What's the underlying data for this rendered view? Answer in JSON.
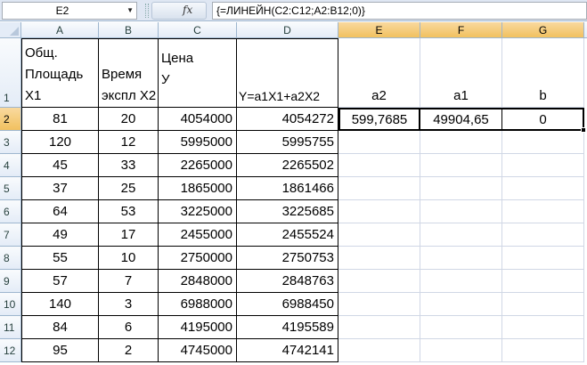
{
  "formula_bar": {
    "name_box": "E2",
    "fx_label": "fx",
    "formula": "{=ЛИНЕЙН(C2:C12;A2:B12;0)}"
  },
  "columns": [
    "A",
    "B",
    "C",
    "D",
    "E",
    "F",
    "G"
  ],
  "row_numbers": [
    "1",
    "2",
    "3",
    "4",
    "5",
    "6",
    "7",
    "8",
    "9",
    "10",
    "11",
    "12"
  ],
  "headers": {
    "A": "Общ. Площадь Х1",
    "B": "Время экспл Х2",
    "C": "Цена У",
    "D": "Y=a1X1+a2X2",
    "E": "a2",
    "F": "a1",
    "G": "b"
  },
  "rows": [
    [
      "81",
      "20",
      "4054000",
      "4054272"
    ],
    [
      "120",
      "12",
      "5995000",
      "5995755"
    ],
    [
      "45",
      "33",
      "2265000",
      "2265502"
    ],
    [
      "37",
      "25",
      "1865000",
      "1861466"
    ],
    [
      "64",
      "53",
      "3225000",
      "3225685"
    ],
    [
      "49",
      "17",
      "2455000",
      "2455524"
    ],
    [
      "55",
      "10",
      "2750000",
      "2750753"
    ],
    [
      "57",
      "7",
      "2848000",
      "2848763"
    ],
    [
      "140",
      "3",
      "6988000",
      "6988450"
    ],
    [
      "84",
      "6",
      "4195000",
      "4195589"
    ],
    [
      "95",
      "2",
      "4745000",
      "4742141"
    ]
  ],
  "results": {
    "E2": "599,7685",
    "F2": "49904,65",
    "G2": "0"
  },
  "colors": {
    "selection_header": "#f1c15f",
    "header_bg": "#e4ecf7",
    "gridline": "#d0d7e5"
  }
}
